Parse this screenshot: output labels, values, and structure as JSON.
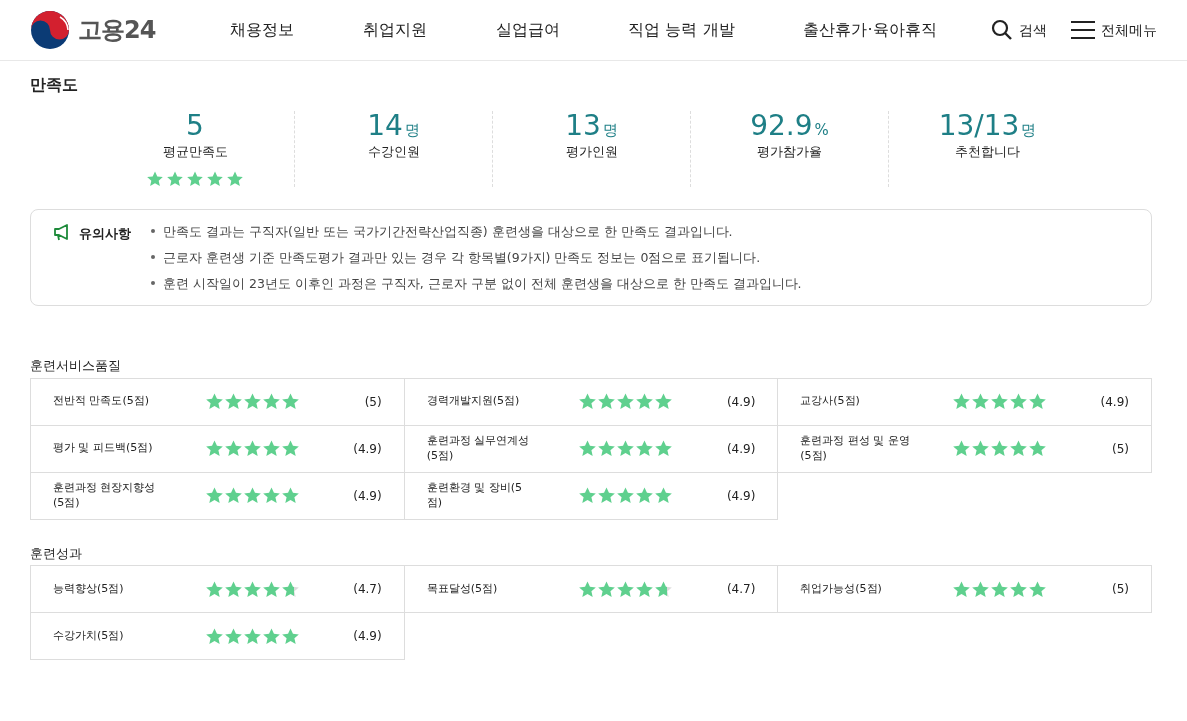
{
  "header": {
    "logo_text": "고용24",
    "nav": [
      "채용정보",
      "취업지원",
      "실업급여",
      "직업 능력 개발",
      "출산휴가·육아휴직"
    ],
    "search_label": "검색",
    "menu_label": "전체메뉴"
  },
  "page_title": "만족도",
  "summary": [
    {
      "value": "5",
      "label": "평균만족도",
      "stars": 5
    },
    {
      "value": "14",
      "unit": "명",
      "label": "수강인원"
    },
    {
      "value": "13",
      "unit": "명",
      "label": "평가인원"
    },
    {
      "value": "92.9",
      "unit": "%",
      "label": "평가참가율"
    },
    {
      "value": "13/13",
      "unit": "명",
      "label": "추천합니다"
    }
  ],
  "notice": {
    "title": "유의사항",
    "items": [
      "만족도 결과는 구직자(일반 또는 국가기간전략산업직종) 훈련생을 대상으로 한 만족도 결과입니다.",
      "근로자 훈련생 기준 만족도평가 결과만 있는 경우 각 항목별(9가지) 만족도 정보는 0점으로 표기됩니다.",
      "훈련 시작일이 23년도 이후인 과정은 구직자, 근로자 구분 없이 전체 훈련생을 대상으로 한 만족도 결과입니다."
    ]
  },
  "sections": [
    {
      "title": "훈련서비스품질",
      "items": [
        {
          "label": "전반적 만족도(5점)",
          "stars": 5,
          "score": "(5)"
        },
        {
          "label": "경력개발지원(5점)",
          "stars": 5,
          "score": "(4.9)"
        },
        {
          "label": "교강사(5점)",
          "stars": 5,
          "score": "(4.9)"
        },
        {
          "label": "평가 및 피드백(5점)",
          "stars": 5,
          "score": "(4.9)"
        },
        {
          "label": "훈련과정 실무연계성(5점)",
          "stars": 5,
          "score": "(4.9)"
        },
        {
          "label": "훈련과정 편성 및 운영(5점)",
          "stars": 5,
          "score": "(5)"
        },
        {
          "label": "훈련과정 현장지향성(5점)",
          "stars": 5,
          "score": "(4.9)"
        },
        {
          "label": "훈련환경 및 장비(5점)",
          "stars": 5,
          "score": "(4.9)"
        }
      ]
    },
    {
      "title": "훈련성과",
      "items": [
        {
          "label": "능력향상(5점)",
          "stars": 4.7,
          "score": "(4.7)"
        },
        {
          "label": "목표달성(5점)",
          "stars": 4.7,
          "score": "(4.7)"
        },
        {
          "label": "취업가능성(5점)",
          "stars": 5,
          "score": "(5)"
        },
        {
          "label": "수강가치(5점)",
          "stars": 5,
          "score": "(4.9)"
        }
      ]
    }
  ]
}
